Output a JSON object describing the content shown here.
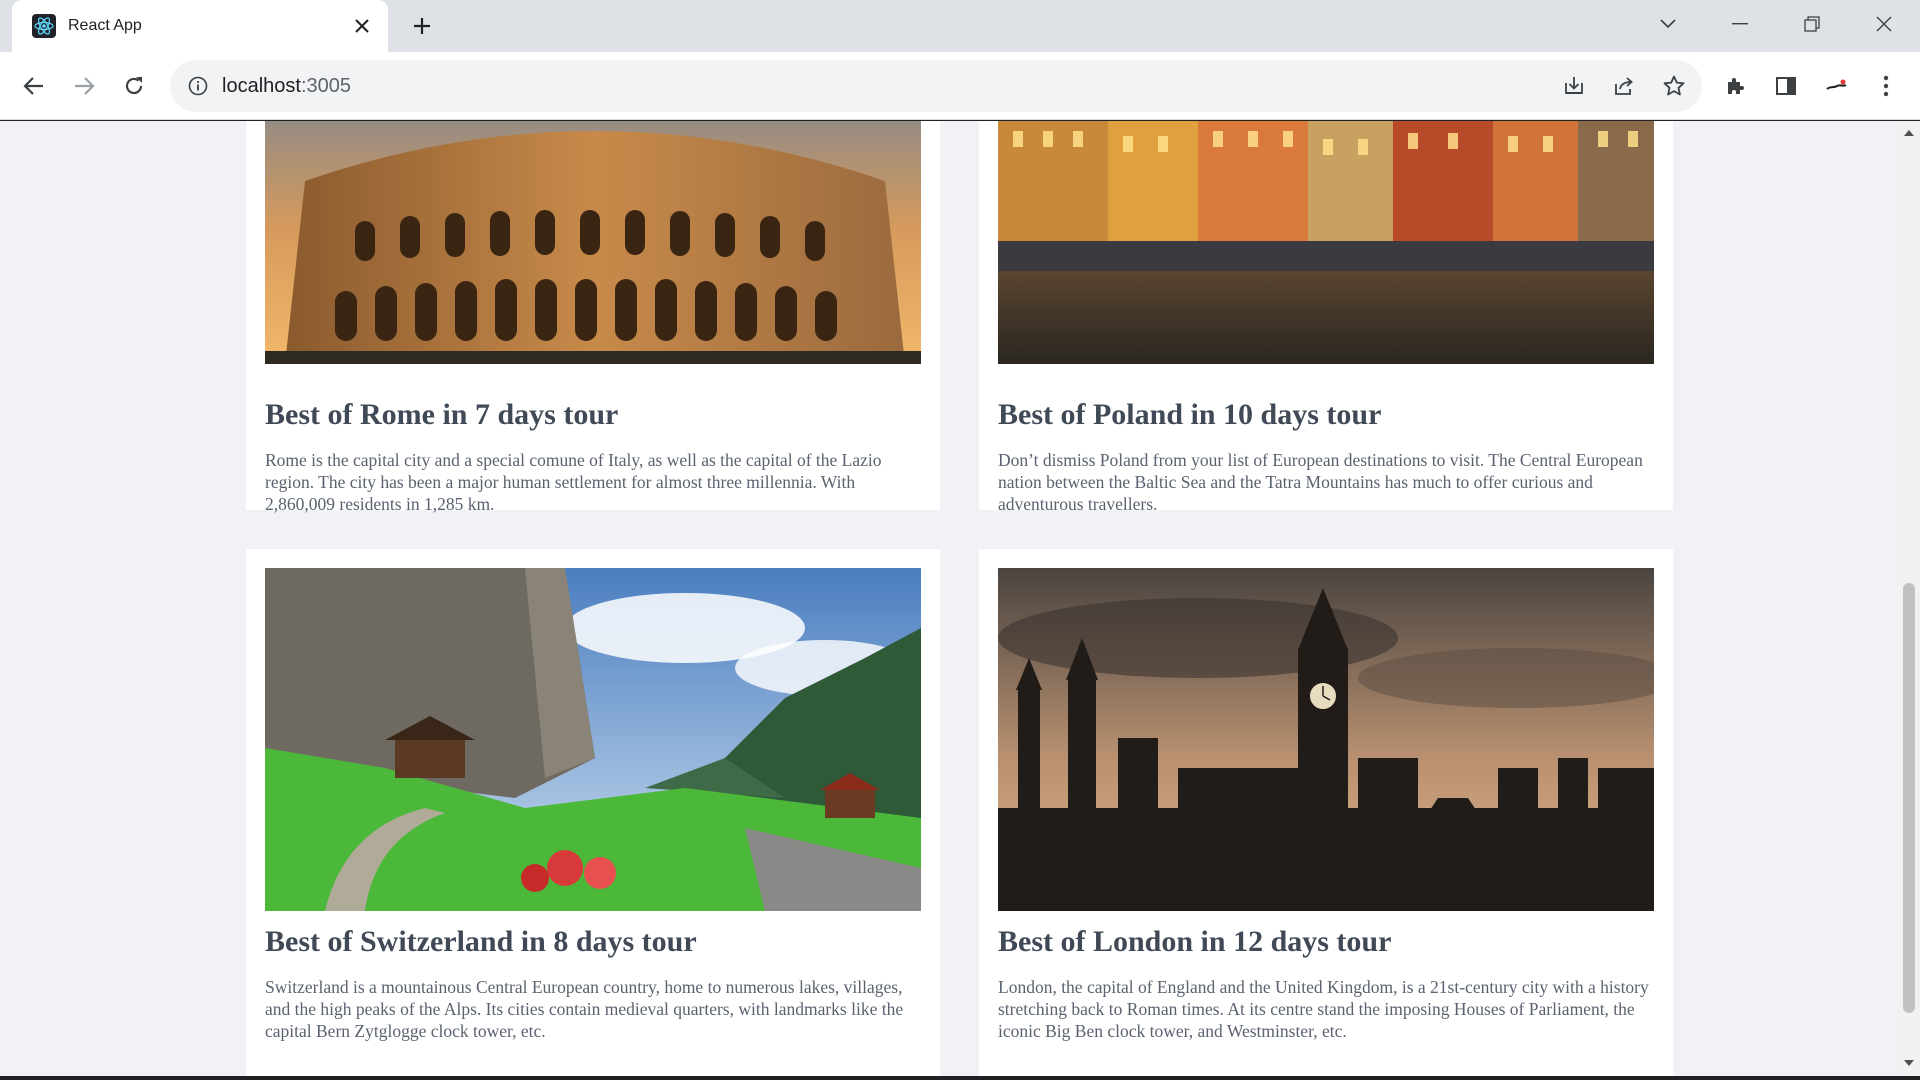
{
  "browser": {
    "tab_title": "React App",
    "url_host": "localhost",
    "url_port": ":3005"
  },
  "cards": [
    {
      "title": "Best of Rome in 7 days tour",
      "description": "Rome is the capital city and a special comune of Italy, as well as the capital of the Lazio region. The city has been a major human settlement for almost three millennia. With 2,860,009 residents in 1,285 km.",
      "image": "colosseum-photo"
    },
    {
      "title": "Best of Poland in 10 days tour",
      "description": "Don’t dismiss Poland from your list of European destinations to visit. The Central European nation between the Baltic Sea and the Tatra Mountains has much to offer curious and adventurous travellers.",
      "image": "poland-town-square-photo"
    },
    {
      "title": "Best of Switzerland in 8 days tour",
      "description": "Switzerland is a mountainous Central European country, home to numerous lakes, villages, and the high peaks of the Alps. Its cities contain medieval quarters, with landmarks like the capital Bern Zytglogge clock tower, etc.",
      "image": "swiss-valley-photo"
    },
    {
      "title": "Best of London in 12 days tour",
      "description": "London, the capital of England and the United Kingdom, is a 21st-century city with a history stretching back to Roman times. At its centre stand the imposing Houses of Parliament, the iconic Big Ben clock tower, and Westminster, etc.",
      "image": "big-ben-photo"
    }
  ]
}
